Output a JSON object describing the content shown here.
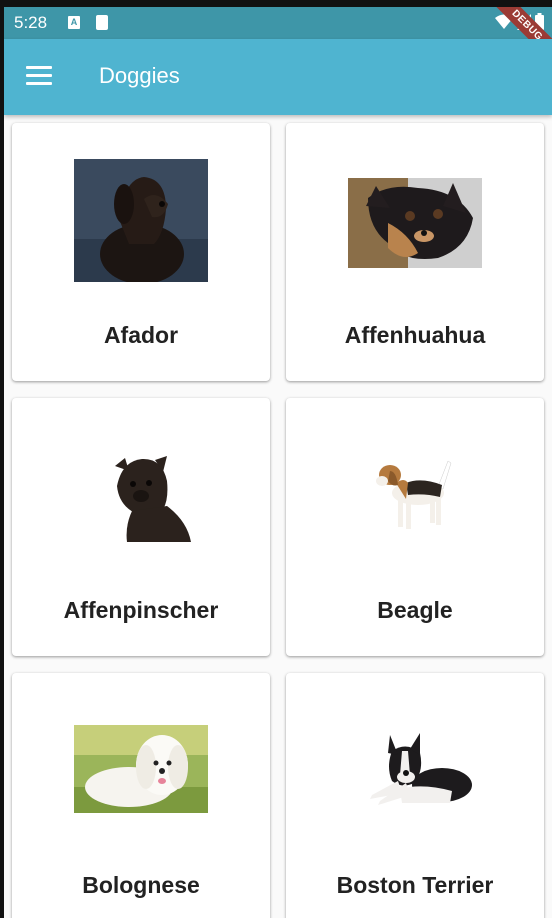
{
  "status_bar": {
    "time": "5:28",
    "icon_a_letter": "A",
    "debug_label": "DEBUG"
  },
  "app_bar": {
    "title": "Doggies"
  },
  "breeds": [
    {
      "name": "Afador"
    },
    {
      "name": "Affenhuahua"
    },
    {
      "name": "Affenpinscher"
    },
    {
      "name": "Beagle"
    },
    {
      "name": "Bolognese"
    },
    {
      "name": "Boston Terrier"
    }
  ],
  "colors": {
    "status_bar": "#3e96a8",
    "app_bar": "#4fb4d0",
    "debug_ribbon": "#9b3b35"
  }
}
